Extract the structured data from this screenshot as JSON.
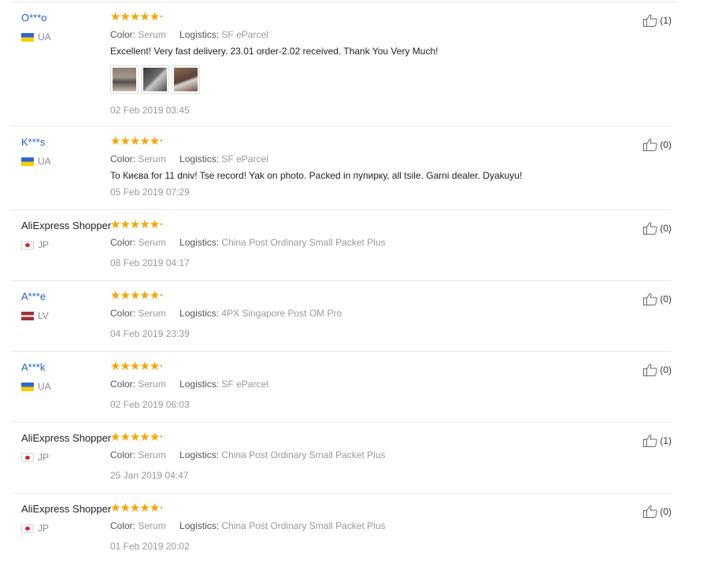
{
  "reviews": [
    {
      "user": "O***o",
      "user_style": "masked",
      "country_code": "UA",
      "flag": "ua",
      "color_label": "Color:",
      "color_value": "Serum",
      "logistics_label": "Logistics:",
      "logistics_value": "SF eParcel",
      "text": "Excellent! Very fast delivery. 23.01 order-2.02 received. Thank You Very Much!",
      "photos": 3,
      "date": "02 Feb 2019 03:45",
      "likes": "(1)",
      "rating": 5
    },
    {
      "user": "K***s",
      "user_style": "masked",
      "country_code": "UA",
      "flag": "ua",
      "color_label": "Color:",
      "color_value": "Serum",
      "logistics_label": "Logistics:",
      "logistics_value": "SF eParcel",
      "text": "To Києва for 11 dniv! Tse record! Yak on photo. Packed in пупирку, all tsile. Garni dealer. Dyakuyu!",
      "photos": 0,
      "date": "05 Feb 2019 07:29",
      "likes": "(0)",
      "rating": 5
    },
    {
      "user": "AliExpress Shopper",
      "user_style": "shopper",
      "country_code": "JP",
      "flag": "jp",
      "color_label": "Color:",
      "color_value": "Serum",
      "logistics_label": "Logistics:",
      "logistics_value": "China Post Ordinary Small Packet Plus",
      "text": "",
      "photos": 0,
      "date": "08 Feb 2019 04:17",
      "likes": "(0)",
      "rating": 5
    },
    {
      "user": "A***e",
      "user_style": "masked",
      "country_code": "LV",
      "flag": "lv",
      "color_label": "Color:",
      "color_value": "Serum",
      "logistics_label": "Logistics:",
      "logistics_value": "4PX Singapore Post OM Pro",
      "text": "",
      "photos": 0,
      "date": "04 Feb 2019 23:39",
      "likes": "(0)",
      "rating": 5
    },
    {
      "user": "A***k",
      "user_style": "masked",
      "country_code": "UA",
      "flag": "ua",
      "color_label": "Color:",
      "color_value": "Serum",
      "logistics_label": "Logistics:",
      "logistics_value": "SF eParcel",
      "text": "",
      "photos": 0,
      "date": "02 Feb 2019 06:03",
      "likes": "(0)",
      "rating": 5
    },
    {
      "user": "AliExpress Shopper",
      "user_style": "shopper",
      "country_code": "JP",
      "flag": "jp",
      "color_label": "Color:",
      "color_value": "Serum",
      "logistics_label": "Logistics:",
      "logistics_value": "China Post Ordinary Small Packet Plus",
      "text": "",
      "photos": 0,
      "date": "25 Jan 2019 04:47",
      "likes": "(1)",
      "rating": 5
    },
    {
      "user": "AliExpress Shopper",
      "user_style": "shopper",
      "country_code": "JP",
      "flag": "jp",
      "color_label": "Color:",
      "color_value": "Serum",
      "logistics_label": "Logistics:",
      "logistics_value": "China Post Ordinary Small Packet Plus",
      "text": "",
      "photos": 0,
      "date": "01 Feb 2019 20:02",
      "likes": "(0)",
      "rating": 5
    }
  ],
  "colors": {
    "username": "#1a63c9",
    "star": "#f8a400",
    "muted": "#999999"
  }
}
